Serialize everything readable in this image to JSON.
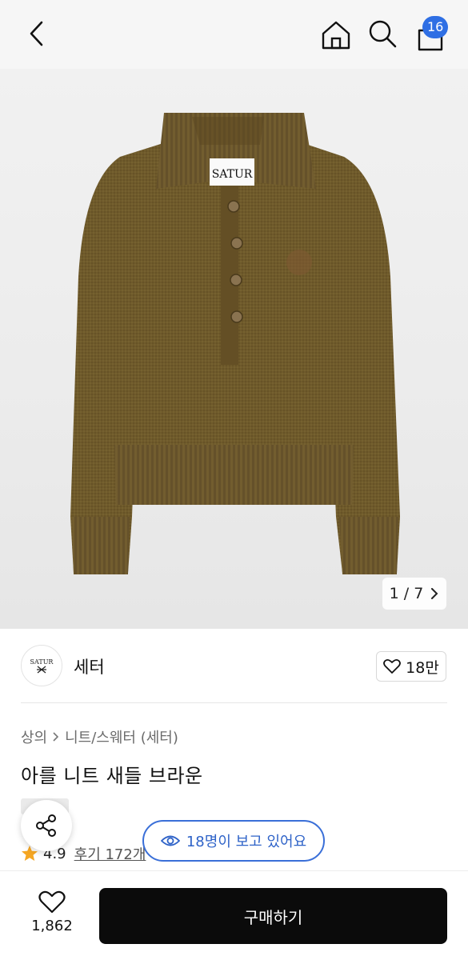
{
  "header": {
    "cart_count": "16",
    "icons": [
      "back-icon",
      "home-icon",
      "search-icon",
      "cart-icon"
    ]
  },
  "gallery": {
    "pager_text": "1 / 7",
    "current": 1,
    "total": 7,
    "label_text": "SATUR"
  },
  "brand": {
    "logo_text": "SATUR",
    "name": "세터",
    "like_count": "18만"
  },
  "product": {
    "breadcrumb": [
      "상의",
      "니트/스웨터 (세터)"
    ],
    "title": "아를 니트 새들 브라운",
    "rating": "4.9",
    "reviews": "후기 172개"
  },
  "floating": {
    "viewers_text": "18명이 보고 있어요"
  },
  "bottom": {
    "wish_count": "1,862",
    "buy_label": "구매하기"
  },
  "colors": {
    "accent": "#2f6fe4",
    "sweater": "#6e5a2a",
    "star": "#f5a623",
    "buy_button": "#0b0b0b"
  }
}
